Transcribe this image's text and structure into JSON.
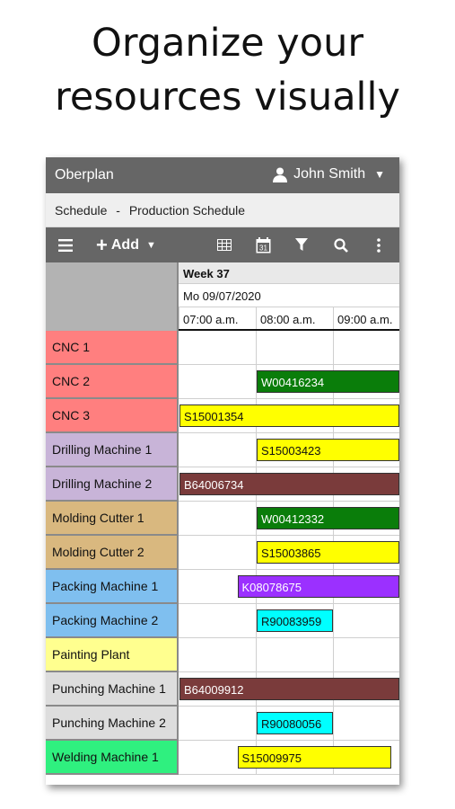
{
  "headline": {
    "line1": "Organize your",
    "line2": "resources visually"
  },
  "app": {
    "title": "Oberplan",
    "user_name": "John Smith",
    "breadcrumb": {
      "section": "Schedule",
      "separator": "-",
      "page": "Production Schedule"
    }
  },
  "toolbar": {
    "menu_icon": "hamburger-icon",
    "add_label": "Add",
    "icons": [
      "grid-view-icon",
      "calendar-icon",
      "filter-icon",
      "search-icon",
      "more-vertical-icon"
    ]
  },
  "timeline": {
    "week": "Week 37",
    "day": "Mo 09/07/2020",
    "hours": [
      "07:00 a.m.",
      "08:00 a.m.",
      "09:00 a.m."
    ]
  },
  "resources": [
    {
      "name": "CNC 1",
      "color": "#ff7f7f"
    },
    {
      "name": "CNC 2",
      "color": "#ff7f7f"
    },
    {
      "name": "CNC 3",
      "color": "#ff7f7f"
    },
    {
      "name": "Drilling Machine 1",
      "color": "#c8b4d8"
    },
    {
      "name": "Drilling Machine 2",
      "color": "#c8b4d8"
    },
    {
      "name": "Molding Cutter 1",
      "color": "#d9b87f"
    },
    {
      "name": "Molding Cutter 2",
      "color": "#d9b87f"
    },
    {
      "name": "Packing Machine 1",
      "color": "#7fbfef"
    },
    {
      "name": "Packing Machine 2",
      "color": "#7fbfef"
    },
    {
      "name": "Painting Plant",
      "color": "#ffff8f"
    },
    {
      "name": "Punching Machine 1",
      "color": "#dddddd"
    },
    {
      "name": "Punching Machine 2",
      "color": "#dddddd"
    },
    {
      "name": "Welding Machine 1",
      "color": "#2ff07f"
    }
  ],
  "tasks": [
    {
      "row": 1,
      "label": "W00416234",
      "start": "08:00",
      "end": "09:50+",
      "color": "#0a7d0a",
      "text_color": "#ffffff"
    },
    {
      "row": 2,
      "label": "S15001354",
      "start": "07:00",
      "end": "09:50+",
      "color": "#ffff00",
      "text_color": "#111111"
    },
    {
      "row": 3,
      "label": "S15003423",
      "start": "08:00",
      "end": "09:50+",
      "color": "#ffff00",
      "text_color": "#111111"
    },
    {
      "row": 4,
      "label": "B64006734",
      "start": "07:00",
      "end": "09:50+",
      "color": "#7a3b3b",
      "text_color": "#ffffff"
    },
    {
      "row": 5,
      "label": "W00412332",
      "start": "08:00",
      "end": "09:50+",
      "color": "#0a7d0a",
      "text_color": "#ffffff"
    },
    {
      "row": 6,
      "label": "S15003865",
      "start": "08:00",
      "end": "09:50+",
      "color": "#ffff00",
      "text_color": "#111111"
    },
    {
      "row": 7,
      "label": "K08078675",
      "start": "07:45",
      "end": "09:50+",
      "color": "#9b30ff",
      "text_color": "#ffffff"
    },
    {
      "row": 8,
      "label": "R90083959",
      "start": "08:00",
      "end": "09:00",
      "color": "#00ffff",
      "text_color": "#111111"
    },
    {
      "row": 10,
      "label": "B64009912",
      "start": "07:00",
      "end": "09:50+",
      "color": "#7a3b3b",
      "text_color": "#ffffff"
    },
    {
      "row": 11,
      "label": "R90080056",
      "start": "08:00",
      "end": "09:00",
      "color": "#00ffff",
      "text_color": "#111111"
    },
    {
      "row": 12,
      "label": "S15009975",
      "start": "07:45",
      "end": "09:45",
      "color": "#ffff00",
      "text_color": "#111111"
    }
  ]
}
